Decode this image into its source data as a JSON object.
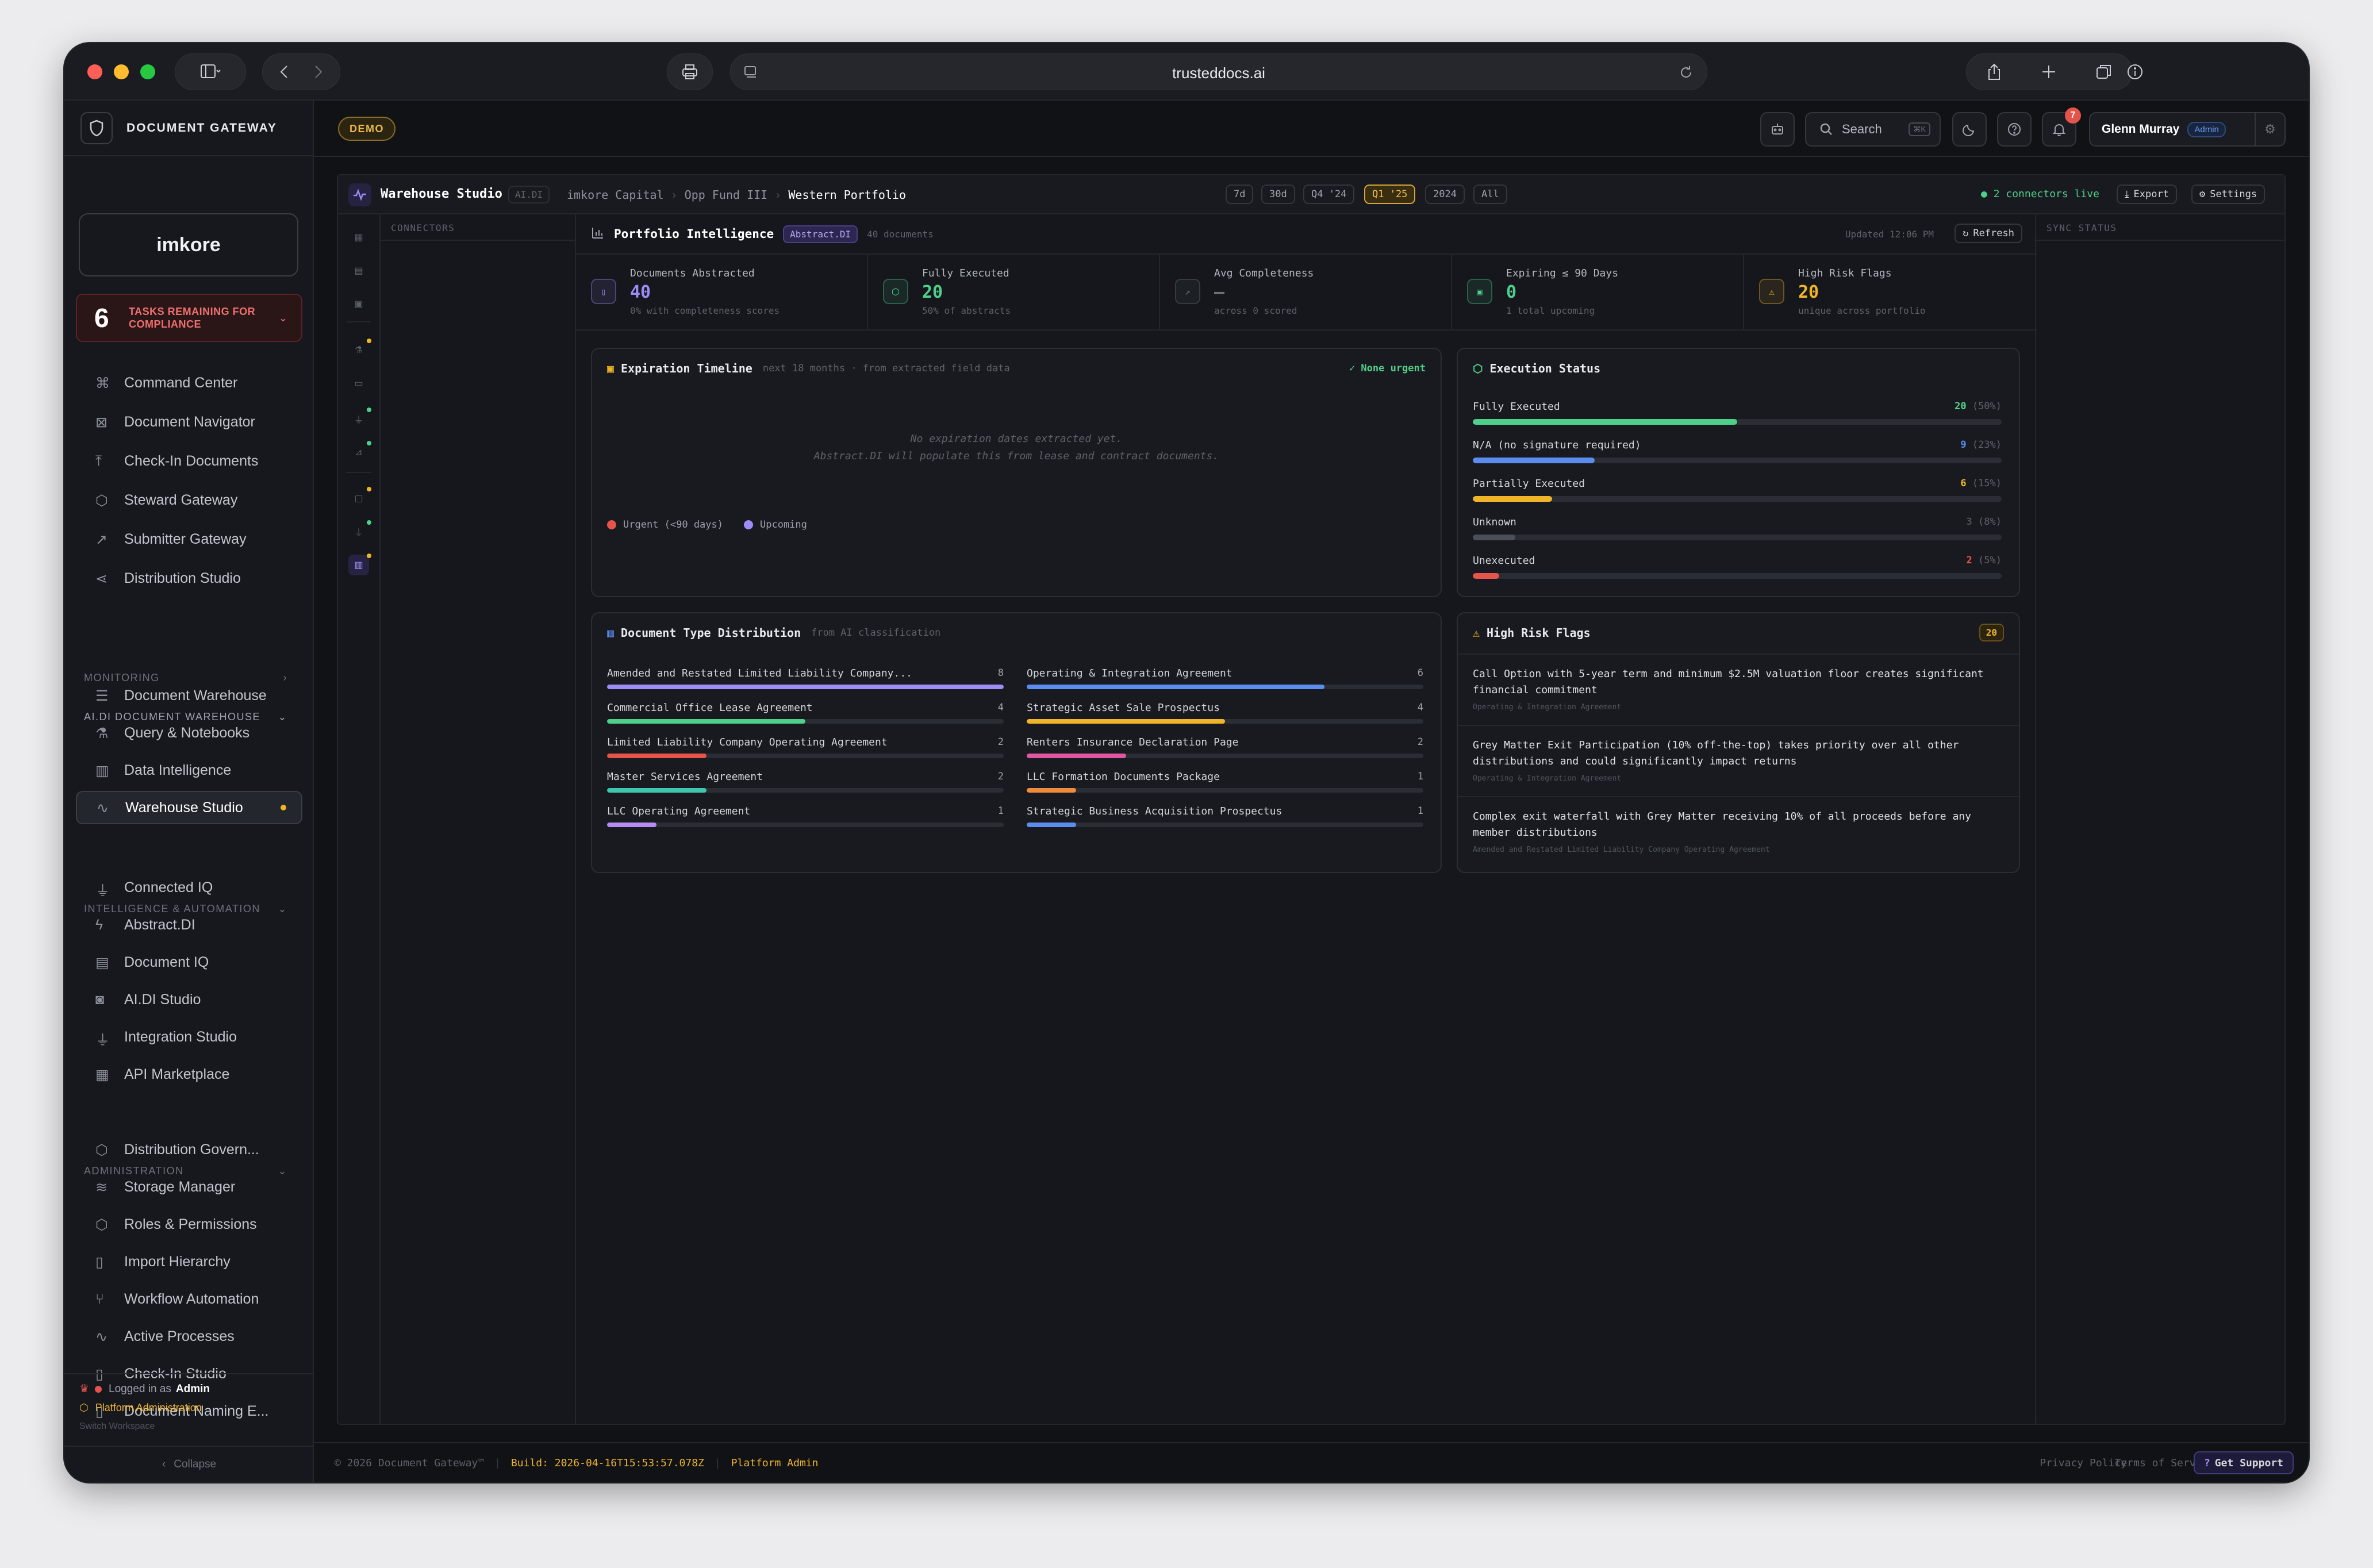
{
  "browser": {
    "url": "trusteddocs.ai"
  },
  "sidebar": {
    "brand": "DOCUMENT GATEWAY",
    "logo_text": "imkore",
    "tasks": {
      "count": "6",
      "label_line1": "TASKS REMAINING FOR",
      "label_line2": "COMPLIANCE"
    },
    "primary": [
      {
        "label": "Command Center",
        "icon": "command-icon"
      },
      {
        "label": "Document Navigator",
        "icon": "navigator-icon"
      },
      {
        "label": "Check-In Documents",
        "icon": "upload-icon"
      },
      {
        "label": "Steward Gateway",
        "icon": "cube-icon"
      },
      {
        "label": "Submitter Gateway",
        "icon": "external-icon"
      },
      {
        "label": "Distribution Studio",
        "icon": "share-icon"
      }
    ],
    "monitoring": "MONITORING",
    "warehouse_section": "AI.DI DOCUMENT WAREHOUSE",
    "warehouse_items": [
      {
        "label": "Document Warehouse",
        "icon": "database-icon"
      },
      {
        "label": "Query & Notebooks",
        "icon": "flask-icon"
      },
      {
        "label": "Data Intelligence",
        "icon": "bar-chart-icon"
      },
      {
        "label": "Warehouse Studio",
        "icon": "activity-icon"
      }
    ],
    "intel_section": "INTELLIGENCE & AUTOMATION",
    "intel_items": [
      {
        "label": "Connected IQ",
        "icon": "plug-icon"
      },
      {
        "label": "Abstract.DI",
        "icon": "bolt-icon"
      },
      {
        "label": "Document IQ",
        "icon": "briefcase-icon"
      },
      {
        "label": "AI.DI Studio",
        "icon": "robot-icon"
      },
      {
        "label": "Integration Studio",
        "icon": "plug-icon"
      },
      {
        "label": "API Marketplace",
        "icon": "store-icon"
      }
    ],
    "admin_section": "ADMINISTRATION",
    "admin_items": [
      {
        "label": "Distribution Govern...",
        "icon": "shield-icon"
      },
      {
        "label": "Storage Manager",
        "icon": "layers-icon"
      },
      {
        "label": "Roles & Permissions",
        "icon": "shield-icon"
      },
      {
        "label": "Import Hierarchy",
        "icon": "file-icon"
      },
      {
        "label": "Workflow Automation",
        "icon": "branch-icon"
      },
      {
        "label": "Active Processes",
        "icon": "activity-icon"
      },
      {
        "label": "Check-In Studio",
        "icon": "file-icon"
      },
      {
        "label": "Document Naming E...",
        "icon": "file-icon"
      }
    ],
    "footer": {
      "logged_in_prefix": "Logged in as",
      "role": "Admin",
      "platform": "Platform Administration",
      "switch": "Switch Workspace",
      "collapse": "Collapse"
    }
  },
  "topbar": {
    "demo": "DEMO",
    "search": "Search",
    "shortcut": "⌘K",
    "notifications": "7",
    "user": "Glenn Murray",
    "user_role": "Admin"
  },
  "studio": {
    "title": "Warehouse Studio",
    "badge": "AI.DI",
    "breadcrumb": [
      "imkore Capital",
      "Opp Fund III",
      "Western Portfolio"
    ],
    "ranges": [
      "7d",
      "30d",
      "Q4 '24",
      "Q1 '25",
      "2024",
      "All"
    ],
    "selected_range": "Q1 '25",
    "connectors_live": "2 connectors live",
    "export": "Export",
    "settings": "Settings",
    "connectors_title": "CONNECTORS",
    "sync_title": "SYNC STATUS"
  },
  "portfolio": {
    "title": "Portfolio Intelligence",
    "badge": "Abstract.DI",
    "docs": "40 documents",
    "updated": "Updated 12:06 PM",
    "refresh": "Refresh",
    "kpis": [
      {
        "label": "Documents Abstracted",
        "value": "40",
        "sub": "0% with completeness scores",
        "color": "#9d8cf5",
        "icon": "document-icon"
      },
      {
        "label": "Fully Executed",
        "value": "20",
        "sub": "50% of abstracts",
        "color": "#4ed08a",
        "icon": "shield-check-icon"
      },
      {
        "label": "Avg Completeness",
        "value": "—",
        "sub": "across 0 scored",
        "color": "#6d717a",
        "icon": "trend-icon"
      },
      {
        "label": "Expiring ≤ 90 Days",
        "value": "0",
        "sub": "1 total upcoming",
        "color": "#4ed08a",
        "icon": "calendar-icon"
      },
      {
        "label": "High Risk Flags",
        "value": "20",
        "sub": "unique across portfolio",
        "color": "#f0b429",
        "icon": "warning-icon"
      }
    ]
  },
  "expiration": {
    "title": "Expiration Timeline",
    "sub": "next 18 months · from extracted field data",
    "status": "✓ None urgent",
    "empty_line1": "No expiration dates extracted yet.",
    "empty_line2": "Abstract.DI will populate this from lease and contract documents.",
    "legend": [
      {
        "label": "Urgent (<90 days)",
        "color": "#e5534b"
      },
      {
        "label": "Upcoming",
        "color": "#9d8cf5"
      }
    ]
  },
  "execution": {
    "title": "Execution Status",
    "rows": [
      {
        "label": "Fully Executed",
        "count": "20",
        "pct": "(50%)",
        "fraction": 0.5,
        "color": "#4ed08a"
      },
      {
        "label": "N/A (no signature required)",
        "count": "9",
        "pct": "(23%)",
        "fraction": 0.23,
        "color": "#5b8def"
      },
      {
        "label": "Partially Executed",
        "count": "6",
        "pct": "(15%)",
        "fraction": 0.15,
        "color": "#f0b429"
      },
      {
        "label": "Unknown",
        "count": "3",
        "pct": "(8%)",
        "fraction": 0.08,
        "color": "#4b4f58"
      },
      {
        "label": "Unexecuted",
        "count": "2",
        "pct": "(5%)",
        "fraction": 0.05,
        "color": "#e5534b"
      }
    ]
  },
  "doctypes": {
    "title": "Document Type Distribution",
    "sub": "from AI classification",
    "left": [
      {
        "label": "Amended and Restated Limited Liability Company...",
        "count": "8",
        "fraction": 1.0,
        "color": "#9d8cf5"
      },
      {
        "label": "Commercial Office Lease Agreement",
        "count": "4",
        "fraction": 0.5,
        "color": "#4ed08a"
      },
      {
        "label": "Limited Liability Company Operating Agreement",
        "count": "2",
        "fraction": 0.25,
        "color": "#e5534b"
      },
      {
        "label": "Master Services Agreement",
        "count": "2",
        "fraction": 0.25,
        "color": "#3fc6b0"
      },
      {
        "label": "LLC Operating Agreement",
        "count": "1",
        "fraction": 0.125,
        "color": "#b48cf5"
      }
    ],
    "right": [
      {
        "label": "Operating & Integration Agreement",
        "count": "6",
        "fraction": 0.75,
        "color": "#5b8def"
      },
      {
        "label": "Strategic Asset Sale Prospectus",
        "count": "4",
        "fraction": 0.5,
        "color": "#f0b429"
      },
      {
        "label": "Renters Insurance Declaration Page",
        "count": "2",
        "fraction": 0.25,
        "color": "#e056a0"
      },
      {
        "label": "LLC Formation Documents Package",
        "count": "1",
        "fraction": 0.125,
        "color": "#f08a3c"
      },
      {
        "label": "Strategic Business Acquisition Prospectus",
        "count": "1",
        "fraction": 0.125,
        "color": "#5b8def"
      }
    ]
  },
  "flags": {
    "title": "High Risk Flags",
    "count": "20",
    "items": [
      {
        "text": "Call Option with 5-year term and minimum $2.5M valuation floor creates significant financial commitment",
        "source": "Operating & Integration Agreement"
      },
      {
        "text": "Grey Matter Exit Participation (10% off-the-top) takes priority over all other distributions and could significantly impact returns",
        "source": "Operating & Integration Agreement"
      },
      {
        "text": "Complex exit waterfall with Grey Matter receiving 10% of all proceeds before any member distributions",
        "source": "Amended and Restated Limited Liability Company Operating Agreement"
      }
    ]
  },
  "footer": {
    "copyright": "© 2026 Document Gateway™",
    "build": "Build: 2026-04-16T15:53:57.078Z",
    "platform": "Platform Admin",
    "privacy": "Privacy Policy",
    "terms": "Terms of Service",
    "support": "Get Support"
  },
  "colors": {
    "accent": "#9d8cf5",
    "gold": "#f0b429",
    "green": "#4ed08a",
    "danger": "#e5534b"
  }
}
